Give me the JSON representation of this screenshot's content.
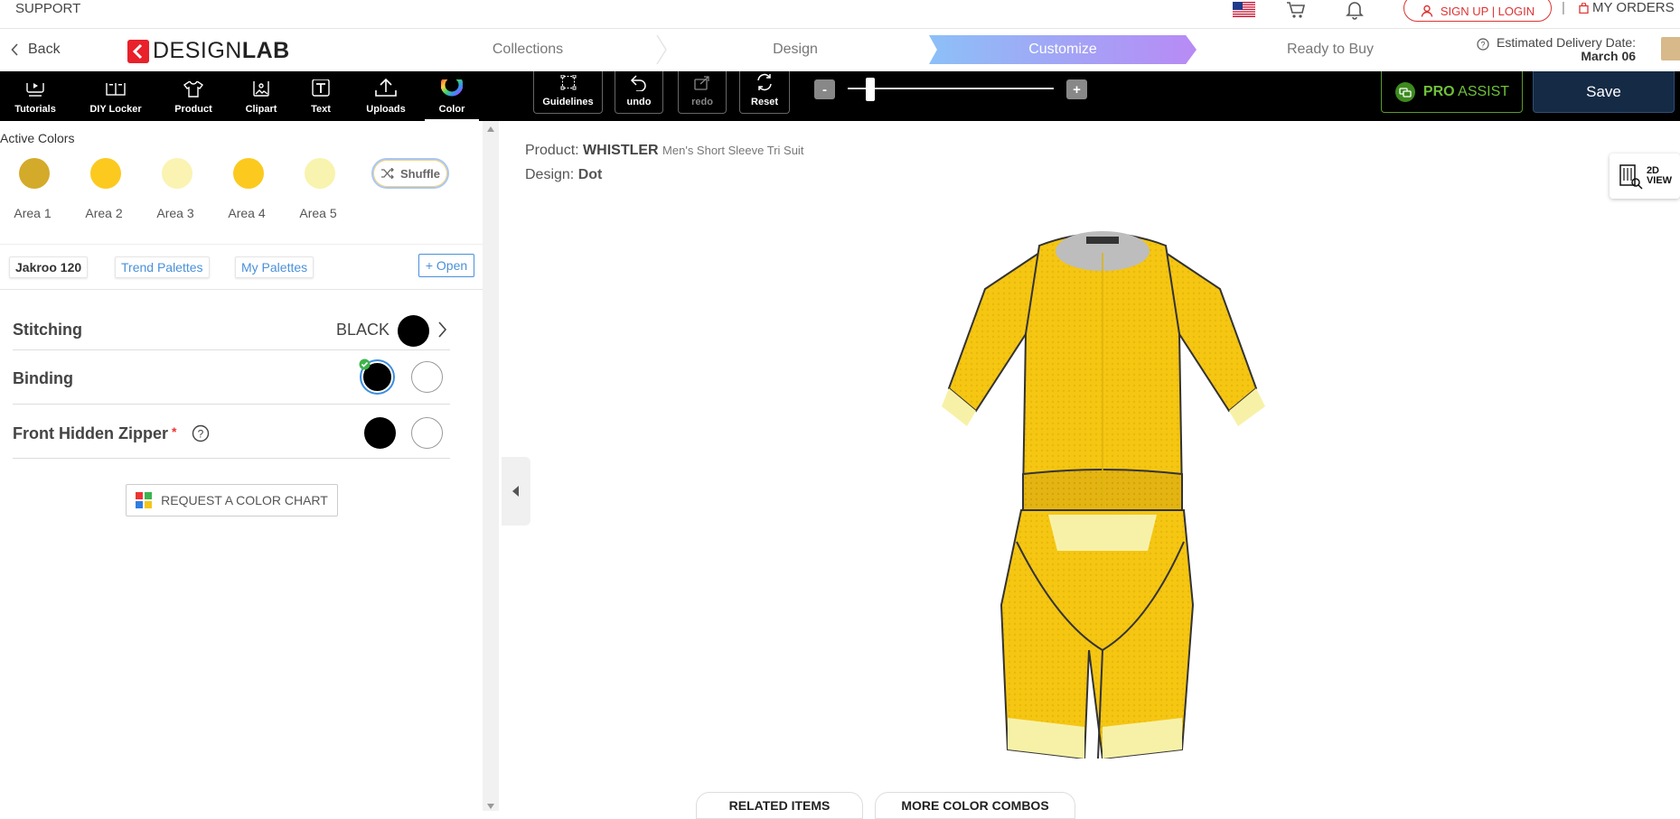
{
  "topbar": {
    "support": "SUPPORT",
    "signup": "SIGN UP | LOGIN",
    "separator": "|",
    "my_orders": "MY ORDERS",
    "icons": [
      "us-flag-icon",
      "cart-icon",
      "bell-icon",
      "user-icon",
      "bag-icon"
    ]
  },
  "nav": {
    "back": "Back",
    "logo_bold": "DESIGN",
    "logo_light": "LAB",
    "steps": [
      "Collections",
      "Design",
      "Customize",
      "Ready to Buy"
    ],
    "active_step": "Customize",
    "delivery_label": "Estimated Delivery Date:",
    "delivery_date": "March 06"
  },
  "toolbar": {
    "tools": [
      "Tutorials",
      "DIY Locker",
      "Product",
      "Clipart",
      "Text",
      "Uploads",
      "Color"
    ],
    "active_tool": "Color",
    "guidelines": "Guidelines",
    "undo": "undo",
    "redo": "redo",
    "reset": "Reset",
    "zoom_minus": "-",
    "zoom_plus": "+",
    "zoom_level": 0.1,
    "pro": "PRO",
    "assist": "ASSIST",
    "save": "Save"
  },
  "colors": {
    "title": "Active Colors",
    "areas": [
      {
        "label": "Area 1",
        "color": "#d4aa2a"
      },
      {
        "label": "Area 2",
        "color": "#fcc91f"
      },
      {
        "label": "Area 3",
        "color": "#faf3b2"
      },
      {
        "label": "Area 4",
        "color": "#fcc91f"
      },
      {
        "label": "Area 5",
        "color": "#f8f3ae"
      }
    ],
    "shuffle": "Shuffle",
    "palettes": [
      "Jakroo 120",
      "Trend Palettes",
      "My Palettes"
    ],
    "open": "+ Open",
    "stitching_label": "Stitching",
    "stitching_value": "BLACK",
    "binding_label": "Binding",
    "zipper_label": "Front Hidden Zipper",
    "required_mark": "*",
    "request_chart": "REQUEST A COLOR CHART"
  },
  "main": {
    "product_label": "Product:",
    "product_name": "WHISTLER",
    "product_desc": "Men's Short Sleeve Tri Suit",
    "design_label": "Design:",
    "design_name": "Dot",
    "view_toggle_top": "2D",
    "view_toggle_bottom": "VIEW",
    "related_items": "RELATED ITEMS",
    "more_combos": "MORE COLOR COMBOS"
  }
}
